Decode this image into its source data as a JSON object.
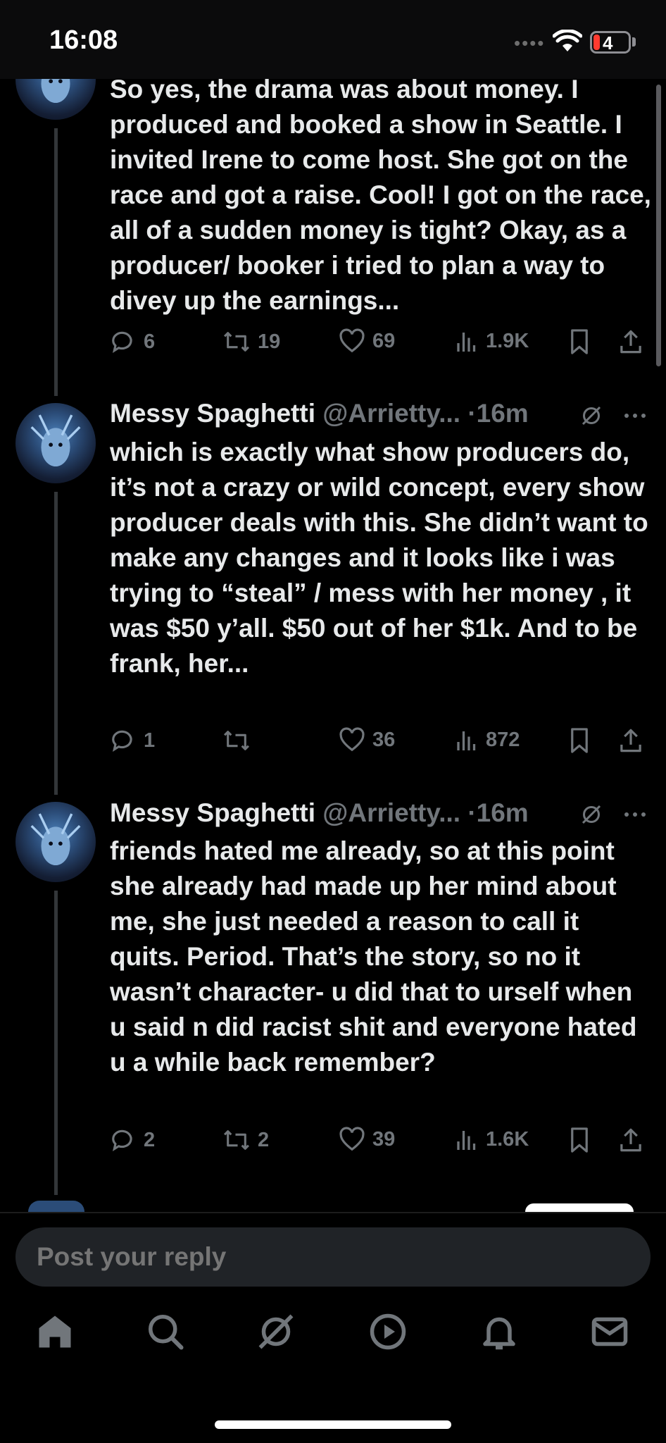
{
  "status_bar": {
    "time": "16:08",
    "battery_level": "4"
  },
  "tweets": [
    {
      "name": "",
      "handle": "",
      "time": "",
      "text": "So yes, the drama was about money. I produced and booked a show in Seattle. I invited Irene to come host. She got on the race and got a raise. Cool! I got on the race, all of a sudden money is tight? Okay, as a producer/ booker i tried to plan a way to divey up the earnings...",
      "replies": "6",
      "reposts": "19",
      "likes": "69",
      "views": "1.9K"
    },
    {
      "name": "Messy Spaghetti",
      "handle": "@Arrietty...",
      "time": "·16m",
      "text": "which is exactly what show producers do, it’s not a crazy or wild concept, every show producer deals with this. She didn’t want to make any changes and it looks like i was trying to “steal” / mess with her money , it was $50 y’all. $50 out of her $1k. And to be frank, her...",
      "replies": "1",
      "reposts": "",
      "likes": "36",
      "views": "872"
    },
    {
      "name": "Messy Spaghetti",
      "handle": "@Arrietty...",
      "time": "·16m",
      "text": "friends hated me already, so at this point she already had made up her mind about me, she just needed a reason to call it quits. Period. That’s the story, so no it wasn’t character- u did that to urself when u said n did racist shit and everyone hated u a while back remember?",
      "replies": "2",
      "reposts": "2",
      "likes": "39",
      "views": "1.6K"
    }
  ],
  "reply_bar": {
    "placeholder": "Post your reply"
  },
  "icons": {
    "tabs": [
      "home-icon",
      "search-icon",
      "grok-icon",
      "video-icon",
      "notifications-icon",
      "messages-icon"
    ],
    "actions": [
      "reply-icon",
      "repost-icon",
      "like-icon",
      "views-icon",
      "bookmark-icon",
      "share-icon"
    ]
  },
  "colors": {
    "background": "#000000",
    "text": "#e7e9ea",
    "muted": "#71767b",
    "input": "#202327"
  }
}
